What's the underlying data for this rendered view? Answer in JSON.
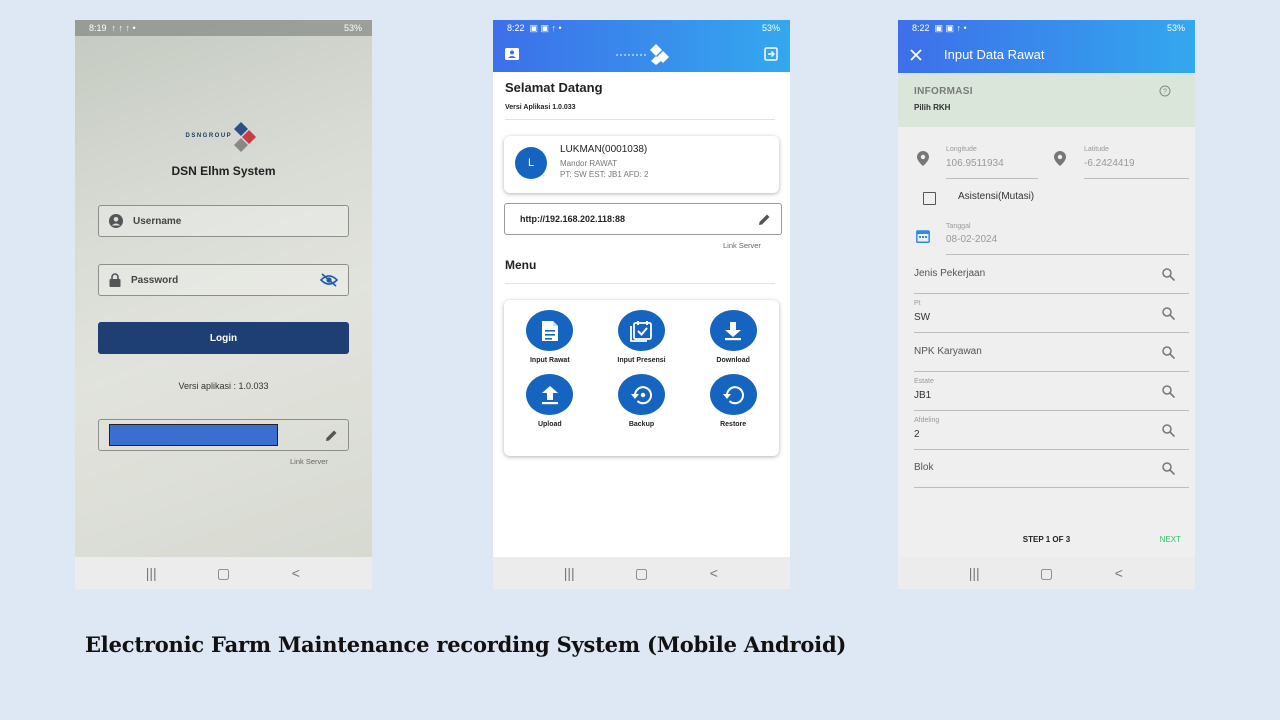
{
  "login_screen": {
    "status": {
      "time": "8:19",
      "left_icons": "↑ ↑ ↑ •",
      "battery": "53%"
    },
    "logo_text": "DSNGROUP",
    "app_title": "DSN Elhm System",
    "username_placeholder": "Username",
    "password_placeholder": "Password",
    "login_label": "Login",
    "version": "Versi aplikasi : 1.0.033",
    "link_server_label": "Link Server"
  },
  "dashboard_screen": {
    "status": {
      "time": "8:22",
      "left_icons": "▣ ▣ ↑ •",
      "battery": "53%"
    },
    "welcome": "Selamat Datang",
    "version": "Versi Aplikasi 1.0.033",
    "user": {
      "initial": "L",
      "name": "LUKMAN(0001038)",
      "role": "Mandor RAWAT",
      "info": "PT: SW EST: JB1 AFD: 2"
    },
    "server_url": "http://192.168.202.118:88",
    "link_server_label": "Link Server",
    "menu_title": "Menu",
    "menu": [
      {
        "label": "Input Rawat",
        "icon": "document-icon"
      },
      {
        "label": "Input Presensi",
        "icon": "checklist-icon"
      },
      {
        "label": "Download",
        "icon": "download-icon"
      },
      {
        "label": "Upload",
        "icon": "upload-icon"
      },
      {
        "label": "Backup",
        "icon": "backup-icon"
      },
      {
        "label": "Restore",
        "icon": "restore-icon"
      }
    ]
  },
  "form_screen": {
    "status": {
      "time": "8:22",
      "left_icons": "▣ ▣ ↑ •",
      "battery": "53%"
    },
    "title": "Input Data Rawat",
    "info_title": "INFORMASI",
    "info_sub": "Pilih RKH",
    "longitude_label": "Longitude",
    "longitude_value": "106.9511934",
    "latitude_label": "Latitude",
    "latitude_value": "-6.2424419",
    "asistensi_label": "Asistensi(Mutasi)",
    "tanggal_label": "Tanggal",
    "tanggal_value": "08-02-2024",
    "fields": [
      {
        "label": "",
        "value": "Jenis Pekerjaan"
      },
      {
        "label": "Pt",
        "value": "SW"
      },
      {
        "label": "",
        "value": "NPK Karyawan"
      },
      {
        "label": "Estate",
        "value": "JB1"
      },
      {
        "label": "Afdeling",
        "value": "2"
      },
      {
        "label": "",
        "value": "Blok"
      }
    ],
    "step": "STEP 1 OF 3",
    "next": "NEXT"
  },
  "caption": "Electronic Farm Maintenance  recording System (Mobile Android)",
  "colors": {
    "brand_blue": "#1e3f73",
    "appbar_start": "#3d6fea",
    "appbar_end": "#33a8ee",
    "menu_blue": "#1565c0",
    "next_green": "#3bbf6b"
  }
}
